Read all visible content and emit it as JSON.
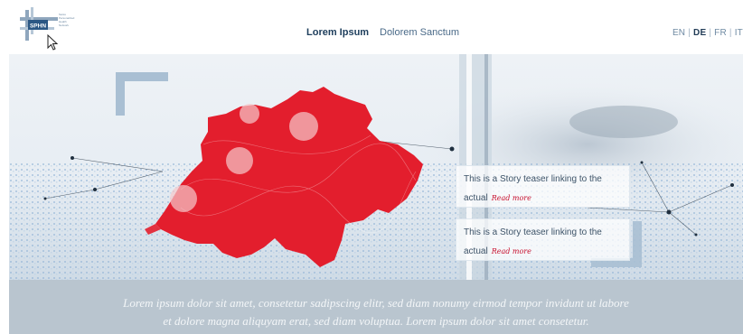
{
  "logo": {
    "text": "SPHN",
    "icon": "sphn-logo",
    "tagline_lines": [
      "Swiss",
      "Personalized",
      "Health",
      "Network"
    ]
  },
  "nav": {
    "primary": "Lorem Ipsum",
    "secondary": "Dolorem Sanctum"
  },
  "languages": {
    "items": [
      "EN",
      "DE",
      "FR",
      "IT"
    ],
    "active": "DE"
  },
  "teasers": [
    {
      "text": "This is a Story teaser linking to the actual",
      "link": "Read more"
    },
    {
      "text": "This is a Story teaser linking to the actual",
      "link": "Read more"
    }
  ],
  "band": {
    "line1": "Lorem ipsum dolor sit amet, consetetur sadipscing elitr, sed diam nonumy eirmod tempor invidunt ut labore",
    "line2": "et dolore magna aliquyam erat, sed diam voluptua. Lorem ipsum dolor sit amet consetetur."
  },
  "colors": {
    "accent_red": "#e31e2d",
    "link_red": "#c8102e",
    "brand_blue": "#1f3a55",
    "band": "#b9c5cf"
  }
}
